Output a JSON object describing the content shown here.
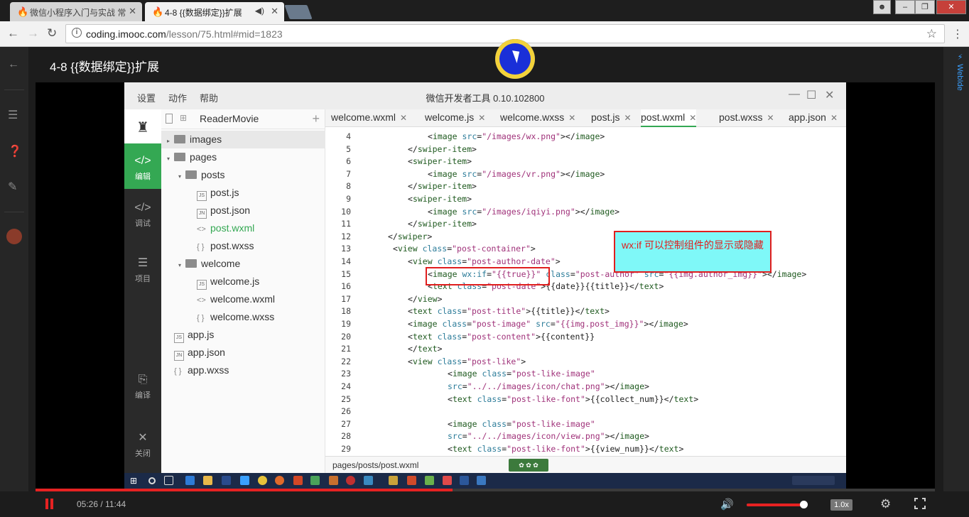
{
  "browser": {
    "tabs": [
      {
        "title": "微信小程序入门与实战 常",
        "active": false
      },
      {
        "title": "4-8 {{数据绑定}}扩展",
        "active": true
      }
    ],
    "url_domain": "coding.imooc.com",
    "url_path": "/lesson/75.html#mid=1823"
  },
  "page": {
    "lesson_title": "4-8 {{数据绑定}}扩展",
    "right_rail_label": "WebIde"
  },
  "ide": {
    "menu": [
      "设置",
      "动作",
      "帮助"
    ],
    "title": "微信开发者工具 0.10.102800",
    "sidebar": [
      {
        "label": "编辑",
        "icon": "code-editor-icon",
        "active": true
      },
      {
        "label": "调试",
        "icon": "debug-icon",
        "active": false
      },
      {
        "label": "项目",
        "icon": "project-icon",
        "active": false
      },
      {
        "label": "编译",
        "icon": "compile-icon",
        "active": false
      },
      {
        "label": "关闭",
        "icon": "close-icon",
        "active": false
      }
    ],
    "project_name": "ReaderMovie",
    "file_tree": [
      {
        "name": "images",
        "kind": "folder",
        "depth": 0,
        "collapsed": true,
        "selected": true
      },
      {
        "name": "pages",
        "kind": "folder",
        "depth": 0,
        "collapsed": false
      },
      {
        "name": "posts",
        "kind": "folder",
        "depth": 1,
        "collapsed": false
      },
      {
        "name": "post.js",
        "kind": "js",
        "depth": 2
      },
      {
        "name": "post.json",
        "kind": "json",
        "depth": 2
      },
      {
        "name": "post.wxml",
        "kind": "wxml",
        "depth": 2,
        "highlight": true
      },
      {
        "name": "post.wxss",
        "kind": "wxss",
        "depth": 2
      },
      {
        "name": "welcome",
        "kind": "folder",
        "depth": 1,
        "collapsed": false
      },
      {
        "name": "welcome.js",
        "kind": "js",
        "depth": 2
      },
      {
        "name": "welcome.wxml",
        "kind": "wxml",
        "depth": 2
      },
      {
        "name": "welcome.wxss",
        "kind": "wxss",
        "depth": 2
      },
      {
        "name": "app.js",
        "kind": "js",
        "depth": 0
      },
      {
        "name": "app.json",
        "kind": "json",
        "depth": 0
      },
      {
        "name": "app.wxss",
        "kind": "wxss",
        "depth": 0
      }
    ],
    "editor_tabs": [
      {
        "name": "welcome.wxml",
        "active": false
      },
      {
        "name": "welcome.js",
        "active": false
      },
      {
        "name": "welcome.wxss",
        "active": false
      },
      {
        "name": "post.js",
        "active": false
      },
      {
        "name": "post.wxml",
        "active": true
      },
      {
        "name": "post.wxss",
        "active": false
      },
      {
        "name": "app.json",
        "active": false
      }
    ],
    "code_lines": [
      {
        "n": "4",
        "indent": 3,
        "tokens": [
          [
            "p",
            "<"
          ],
          [
            "t",
            "image "
          ],
          [
            "a",
            "src"
          ],
          [
            "p",
            "="
          ],
          [
            "s",
            "\"/images/wx.png\""
          ],
          [
            "p",
            "></"
          ],
          [
            "t",
            "image"
          ],
          [
            "p",
            ">"
          ]
        ]
      },
      {
        "n": "5",
        "indent": 2,
        "tokens": [
          [
            "p",
            "</"
          ],
          [
            "t",
            "swiper-item"
          ],
          [
            "p",
            ">"
          ]
        ]
      },
      {
        "n": "6",
        "indent": 2,
        "tokens": [
          [
            "p",
            "<"
          ],
          [
            "t",
            "swiper-item"
          ],
          [
            "p",
            ">"
          ]
        ]
      },
      {
        "n": "7",
        "indent": 3,
        "tokens": [
          [
            "p",
            "<"
          ],
          [
            "t",
            "image "
          ],
          [
            "a",
            "src"
          ],
          [
            "p",
            "="
          ],
          [
            "s",
            "\"/images/vr.png\""
          ],
          [
            "p",
            "></"
          ],
          [
            "t",
            "image"
          ],
          [
            "p",
            ">"
          ]
        ]
      },
      {
        "n": "8",
        "indent": 2,
        "tokens": [
          [
            "p",
            "</"
          ],
          [
            "t",
            "swiper-item"
          ],
          [
            "p",
            ">"
          ]
        ]
      },
      {
        "n": "9",
        "indent": 2,
        "tokens": [
          [
            "p",
            "<"
          ],
          [
            "t",
            "swiper-item"
          ],
          [
            "p",
            ">"
          ]
        ]
      },
      {
        "n": "10",
        "indent": 3,
        "tokens": [
          [
            "p",
            "<"
          ],
          [
            "t",
            "image "
          ],
          [
            "a",
            "src"
          ],
          [
            "p",
            "="
          ],
          [
            "s",
            "\"/images/iqiyi.png\""
          ],
          [
            "p",
            "></"
          ],
          [
            "t",
            "image"
          ],
          [
            "p",
            ">"
          ]
        ]
      },
      {
        "n": "11",
        "indent": 2,
        "tokens": [
          [
            "p",
            "</"
          ],
          [
            "t",
            "swiper-item"
          ],
          [
            "p",
            ">"
          ]
        ]
      },
      {
        "n": "12",
        "indent": 1,
        "tokens": [
          [
            "p",
            "</"
          ],
          [
            "t",
            "swiper"
          ],
          [
            "p",
            ">"
          ]
        ]
      },
      {
        "n": "13",
        "indent": 1.25,
        "tokens": [
          [
            "p",
            "<"
          ],
          [
            "t",
            "view "
          ],
          [
            "a",
            "class"
          ],
          [
            "p",
            "="
          ],
          [
            "s",
            "\"post-container\""
          ],
          [
            "p",
            ">"
          ]
        ]
      },
      {
        "n": "14",
        "indent": 2,
        "tokens": [
          [
            "p",
            "<"
          ],
          [
            "t",
            "view "
          ],
          [
            "a",
            "class"
          ],
          [
            "p",
            "="
          ],
          [
            "s",
            "\"post-author-date\""
          ],
          [
            "p",
            ">"
          ]
        ]
      },
      {
        "n": "15",
        "indent": 3,
        "tokens": [
          [
            "p",
            "<"
          ],
          [
            "t",
            "image "
          ],
          [
            "a",
            "wx:if"
          ],
          [
            "p",
            "="
          ],
          [
            "s",
            "\"{{true}}\""
          ],
          [
            "p",
            " "
          ],
          [
            "a",
            "class"
          ],
          [
            "p",
            "="
          ],
          [
            "s",
            "\"post-author\""
          ],
          [
            "p",
            " "
          ],
          [
            "a",
            "src"
          ],
          [
            "p",
            "="
          ],
          [
            "s",
            "\"{{img.author_img}}\""
          ],
          [
            "p",
            "></"
          ],
          [
            "t",
            "image"
          ],
          [
            "p",
            ">"
          ]
        ]
      },
      {
        "n": "16",
        "indent": 3,
        "tokens": [
          [
            "p",
            "<"
          ],
          [
            "t",
            "text "
          ],
          [
            "a",
            "class"
          ],
          [
            "p",
            "="
          ],
          [
            "s",
            "\"post-date\""
          ],
          [
            "p",
            ">{{date}}{{title}}</"
          ],
          [
            "t",
            "text"
          ],
          [
            "p",
            ">"
          ]
        ]
      },
      {
        "n": "17",
        "indent": 2,
        "tokens": [
          [
            "p",
            "</"
          ],
          [
            "t",
            "view"
          ],
          [
            "p",
            ">"
          ]
        ]
      },
      {
        "n": "18",
        "indent": 2,
        "tokens": [
          [
            "p",
            "<"
          ],
          [
            "t",
            "text "
          ],
          [
            "a",
            "class"
          ],
          [
            "p",
            "="
          ],
          [
            "s",
            "\"post-title\""
          ],
          [
            "p",
            ">{{title}}</"
          ],
          [
            "t",
            "text"
          ],
          [
            "p",
            ">"
          ]
        ]
      },
      {
        "n": "19",
        "indent": 2,
        "tokens": [
          [
            "p",
            "<"
          ],
          [
            "t",
            "image "
          ],
          [
            "a",
            "class"
          ],
          [
            "p",
            "="
          ],
          [
            "s",
            "\"post-image\""
          ],
          [
            "p",
            " "
          ],
          [
            "a",
            "src"
          ],
          [
            "p",
            "="
          ],
          [
            "s",
            "\"{{img.post_img}}\""
          ],
          [
            "p",
            "></"
          ],
          [
            "t",
            "image"
          ],
          [
            "p",
            ">"
          ]
        ]
      },
      {
        "n": "20",
        "indent": 2,
        "tokens": [
          [
            "p",
            "<"
          ],
          [
            "t",
            "text "
          ],
          [
            "a",
            "class"
          ],
          [
            "p",
            "="
          ],
          [
            "s",
            "\"post-content\""
          ],
          [
            "p",
            ">{{content}}"
          ]
        ]
      },
      {
        "n": "21",
        "indent": 2,
        "tokens": [
          [
            "p",
            "</"
          ],
          [
            "t",
            "text"
          ],
          [
            "p",
            ">"
          ]
        ]
      },
      {
        "n": "22",
        "indent": 2,
        "tokens": [
          [
            "p",
            "<"
          ],
          [
            "t",
            "view "
          ],
          [
            "a",
            "class"
          ],
          [
            "p",
            "="
          ],
          [
            "s",
            "\"post-like\""
          ],
          [
            "p",
            ">"
          ]
        ]
      },
      {
        "n": "23",
        "indent": 4,
        "tokens": [
          [
            "p",
            "<"
          ],
          [
            "t",
            "image "
          ],
          [
            "a",
            "class"
          ],
          [
            "p",
            "="
          ],
          [
            "s",
            "\"post-like-image\""
          ]
        ]
      },
      {
        "n": "24",
        "indent": 4,
        "tokens": [
          [
            "a",
            "src"
          ],
          [
            "p",
            "="
          ],
          [
            "s",
            "\"../../images/icon/chat.png\""
          ],
          [
            "p",
            "></"
          ],
          [
            "t",
            "image"
          ],
          [
            "p",
            ">"
          ]
        ]
      },
      {
        "n": "25",
        "indent": 4,
        "tokens": [
          [
            "p",
            "<"
          ],
          [
            "t",
            "text "
          ],
          [
            "a",
            "class"
          ],
          [
            "p",
            "="
          ],
          [
            "s",
            "\"post-like-font\""
          ],
          [
            "p",
            ">{{collect_num}}</"
          ],
          [
            "t",
            "text"
          ],
          [
            "p",
            ">"
          ]
        ]
      },
      {
        "n": "26",
        "indent": 0,
        "tokens": []
      },
      {
        "n": "27",
        "indent": 4,
        "tokens": [
          [
            "p",
            "<"
          ],
          [
            "t",
            "image "
          ],
          [
            "a",
            "class"
          ],
          [
            "p",
            "="
          ],
          [
            "s",
            "\"post-like-image\""
          ]
        ]
      },
      {
        "n": "28",
        "indent": 4,
        "tokens": [
          [
            "a",
            "src"
          ],
          [
            "p",
            "="
          ],
          [
            "s",
            "\"../../images/icon/view.png\""
          ],
          [
            "p",
            "></"
          ],
          [
            "t",
            "image"
          ],
          [
            "p",
            ">"
          ]
        ]
      },
      {
        "n": "29",
        "indent": 4,
        "tokens": [
          [
            "p",
            "<"
          ],
          [
            "t",
            "text "
          ],
          [
            "a",
            "class"
          ],
          [
            "p",
            "="
          ],
          [
            "s",
            "\"post-like-font\""
          ],
          [
            "p",
            ">{{view_num}}</"
          ],
          [
            "t",
            "text"
          ],
          [
            "p",
            ">"
          ]
        ]
      }
    ],
    "status_path": "pages/posts/post.wxml"
  },
  "annotation": {
    "note_text": "wx:if 可以控制组件的显示或隐藏"
  },
  "player": {
    "time_current": "05:26",
    "time_total": "11:44",
    "time_display": "05:26 / 11:44",
    "progress_fraction": 0.464,
    "volume_fraction": 1.0,
    "speed": "1.0x"
  },
  "colors": {
    "accent_red": "#e62222",
    "ide_green": "#34a853",
    "note_bg": "#7ff8f8"
  }
}
